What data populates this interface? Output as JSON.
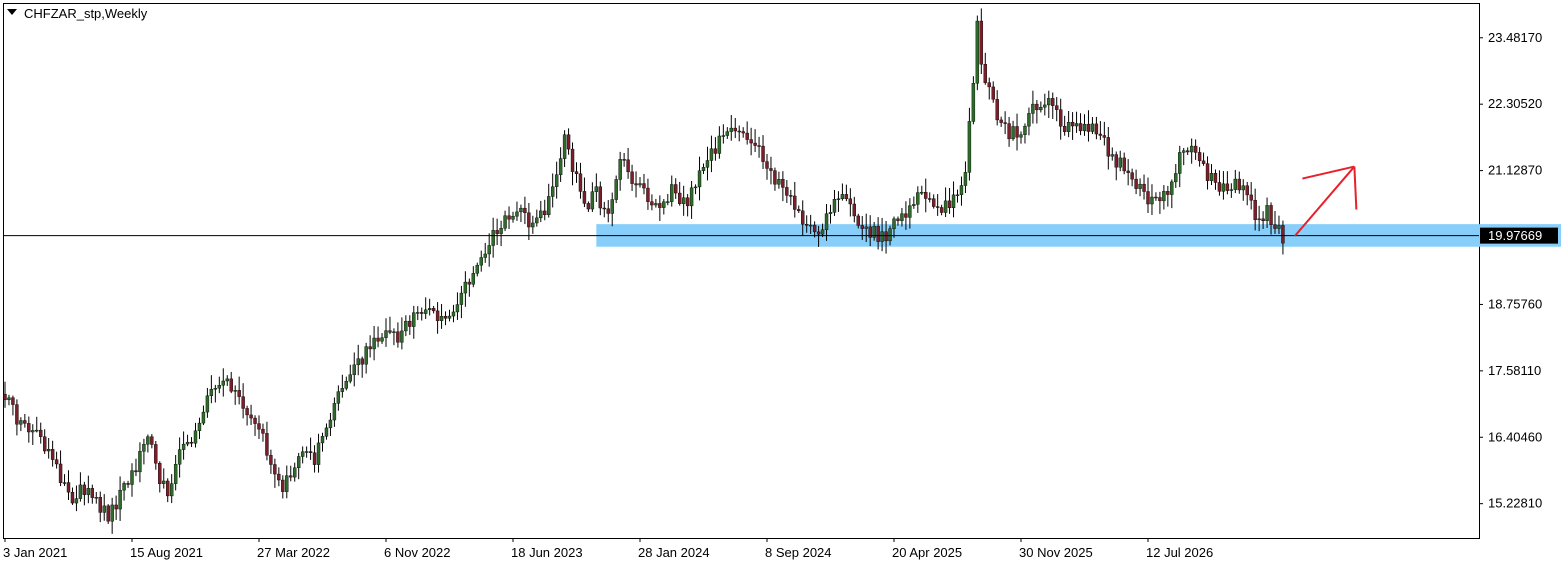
{
  "header": {
    "symbol": "CHFZAR_stp",
    "timeframe": "Weekly",
    "title": "CHFZAR_stp,Weekly"
  },
  "colors": {
    "background": "#ffffff",
    "frame": "#000000",
    "bull_candle": "#2e6b2a",
    "bear_candle": "#7a1f2a",
    "wick": "#000000",
    "support_zone": "#87cefa",
    "current_price_line": "#000000",
    "arrow": "#e8202a",
    "price_label_bg": "#000000",
    "price_label_text": "#ffffff"
  },
  "chart_data": {
    "type": "candlestick",
    "title": "CHFZAR_stp,Weekly",
    "ylim": [
      14.62,
      24.08
    ],
    "y_ticks": [
      "23.48170",
      "22.30520",
      "21.12870",
      "18.75760",
      "17.58110",
      "16.40460",
      "15.22810"
    ],
    "current_price": "19.97669",
    "x_ticks": [
      "3 Jan 2021",
      "15 Aug 2021",
      "27 Mar 2022",
      "6 Nov 2022",
      "18 Jun 2023",
      "28 Jan 2024",
      "8 Sep 2024",
      "20 Apr 2025",
      "30 Nov 2025",
      "12 Jul 2026"
    ],
    "weeks_per_tick": 32,
    "visible_weeks": 295,
    "anchors": [
      [
        0,
        17.2
      ],
      [
        3,
        16.75
      ],
      [
        8,
        16.45
      ],
      [
        12,
        16.05
      ],
      [
        14,
        15.6
      ],
      [
        17,
        15.35
      ],
      [
        21,
        15.5
      ],
      [
        24,
        15.2
      ],
      [
        26,
        14.95
      ],
      [
        29,
        15.35
      ],
      [
        33,
        15.9
      ],
      [
        36,
        16.5
      ],
      [
        39,
        15.6
      ],
      [
        41,
        15.4
      ],
      [
        44,
        16.15
      ],
      [
        47,
        16.4
      ],
      [
        50,
        16.9
      ],
      [
        53,
        17.35
      ],
      [
        56,
        17.45
      ],
      [
        59,
        17.0
      ],
      [
        62,
        16.75
      ],
      [
        65,
        16.35
      ],
      [
        67,
        16.0
      ],
      [
        70,
        15.45
      ],
      [
        72,
        15.75
      ],
      [
        75,
        16.25
      ],
      [
        78,
        16.05
      ],
      [
        81,
        16.6
      ],
      [
        84,
        17.25
      ],
      [
        88,
        17.6
      ],
      [
        91,
        17.9
      ],
      [
        95,
        18.3
      ],
      [
        99,
        18.15
      ],
      [
        102,
        18.45
      ],
      [
        106,
        18.7
      ],
      [
        110,
        18.45
      ],
      [
        114,
        18.85
      ],
      [
        117,
        19.25
      ],
      [
        120,
        19.55
      ],
      [
        123,
        19.95
      ],
      [
        126,
        20.3
      ],
      [
        130,
        20.5
      ],
      [
        133,
        20.15
      ],
      [
        137,
        20.55
      ],
      [
        139,
        21.05
      ],
      [
        141,
        21.8
      ],
      [
        143,
        21.25
      ],
      [
        146,
        20.45
      ],
      [
        149,
        20.75
      ],
      [
        152,
        20.25
      ],
      [
        155,
        21.3
      ],
      [
        158,
        20.95
      ],
      [
        162,
        20.65
      ],
      [
        165,
        20.5
      ],
      [
        168,
        20.75
      ],
      [
        172,
        20.55
      ],
      [
        176,
        21.2
      ],
      [
        180,
        21.65
      ],
      [
        184,
        21.9
      ],
      [
        188,
        21.65
      ],
      [
        192,
        21.25
      ],
      [
        195,
        20.85
      ],
      [
        198,
        20.55
      ],
      [
        201,
        20.15
      ],
      [
        205,
        19.95
      ],
      [
        208,
        20.45
      ],
      [
        212,
        20.75
      ],
      [
        215,
        20.25
      ],
      [
        218,
        20.05
      ],
      [
        221,
        19.95
      ],
      [
        224,
        20.15
      ],
      [
        227,
        20.35
      ],
      [
        230,
        20.75
      ],
      [
        233,
        20.6
      ],
      [
        236,
        20.45
      ],
      [
        239,
        20.6
      ],
      [
        242,
        21.05
      ],
      [
        244,
        22.7
      ],
      [
        245,
        23.65
      ],
      [
        246,
        22.95
      ],
      [
        248,
        22.55
      ],
      [
        250,
        22.1
      ],
      [
        253,
        21.75
      ],
      [
        256,
        21.9
      ],
      [
        259,
        22.2
      ],
      [
        262,
        22.35
      ],
      [
        265,
        22.15
      ],
      [
        268,
        21.85
      ],
      [
        272,
        21.95
      ],
      [
        276,
        21.7
      ],
      [
        280,
        21.3
      ],
      [
        284,
        21.0
      ],
      [
        288,
        20.55
      ],
      [
        292,
        20.65
      ],
      [
        296,
        21.4
      ],
      [
        299,
        21.6
      ],
      [
        302,
        21.15
      ],
      [
        306,
        20.8
      ],
      [
        310,
        20.9
      ],
      [
        313,
        20.65
      ],
      [
        316,
        20.2
      ],
      [
        318,
        20.45
      ],
      [
        320,
        20.1
      ],
      [
        322,
        19.95
      ]
    ],
    "support_zone": {
      "low": 19.78,
      "high": 20.18,
      "from_week": 149,
      "to_week": 394
    },
    "forecast_arrow": {
      "from": [
        325,
        19.97
      ],
      "to": [
        340,
        21.2
      ],
      "direction": "up"
    }
  }
}
